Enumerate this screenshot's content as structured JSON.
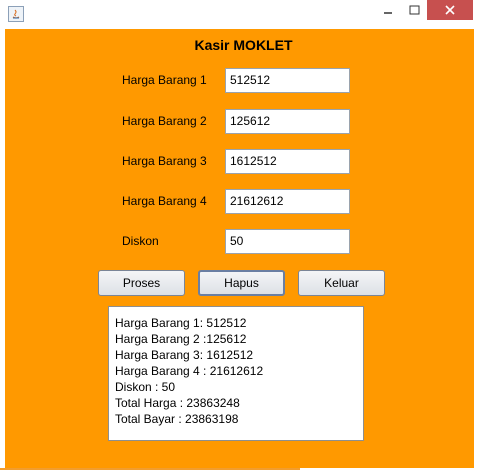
{
  "window": {
    "controls": {
      "minimize": "—",
      "maximize": "☐",
      "close": "✕"
    }
  },
  "form": {
    "title": "Kasir MOKLET",
    "fields": [
      {
        "label": "Harga Barang 1",
        "value": "512512"
      },
      {
        "label": "Harga Barang 2",
        "value": "125612"
      },
      {
        "label": "Harga Barang 3",
        "value": "1612512"
      },
      {
        "label": "Harga Barang 4",
        "value": "21612612"
      },
      {
        "label": "Diskon",
        "value": "50"
      }
    ],
    "buttons": {
      "proses": "Proses",
      "hapus": "Hapus",
      "keluar": "Keluar"
    },
    "output_lines": [
      "Harga Barang 1: 512512",
      "Harga Barang 2 :125612",
      "Harga Barang 3: 1612512",
      "Harga Barang 4 : 21612612",
      "Diskon : 50",
      "Total Harga : 23863248",
      "Total Bayar : 23863198"
    ]
  },
  "colors": {
    "background": "#ff9900",
    "close_button": "#c7504f"
  }
}
